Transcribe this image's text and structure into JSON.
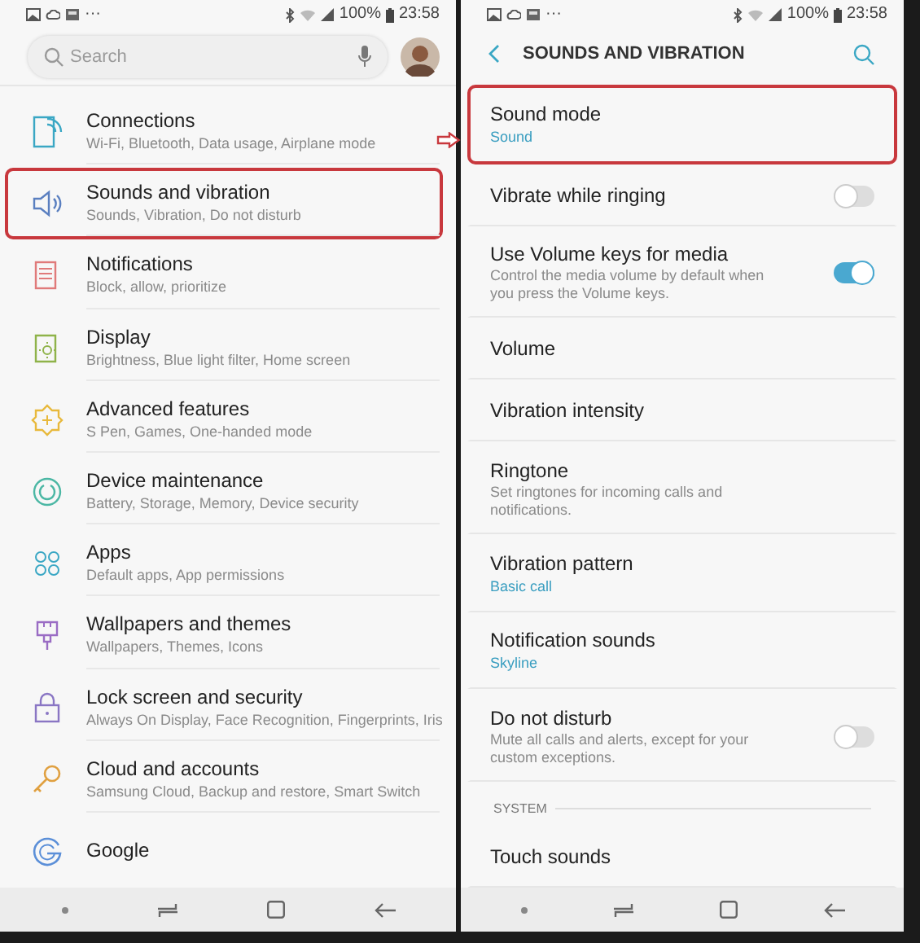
{
  "left_screen": {
    "status_bar": {
      "overflow": "···",
      "battery": "100%",
      "time": "23:58"
    },
    "search": {
      "placeholder": "Search"
    },
    "settings": [
      {
        "title": "Connections",
        "subtitle": "Wi-Fi, Bluetooth, Data usage, Airplane mode",
        "highlighted": false
      },
      {
        "title": "Sounds and vibration",
        "subtitle": "Sounds, Vibration, Do not disturb",
        "highlighted": true
      },
      {
        "title": "Notifications",
        "subtitle": "Block, allow, prioritize",
        "highlighted": false
      },
      {
        "title": "Display",
        "subtitle": "Brightness, Blue light filter, Home screen",
        "highlighted": false
      },
      {
        "title": "Advanced features",
        "subtitle": "S Pen, Games, One-handed mode",
        "highlighted": false
      },
      {
        "title": "Device maintenance",
        "subtitle": "Battery, Storage, Memory, Device security",
        "highlighted": false
      },
      {
        "title": "Apps",
        "subtitle": "Default apps, App permissions",
        "highlighted": false
      },
      {
        "title": "Wallpapers and themes",
        "subtitle": "Wallpapers, Themes, Icons",
        "highlighted": false
      },
      {
        "title": "Lock screen and security",
        "subtitle": "Always On Display, Face Recognition, Fingerprints, Iris",
        "highlighted": false
      },
      {
        "title": "Cloud and accounts",
        "subtitle": "Samsung Cloud, Backup and restore, Smart Switch",
        "highlighted": false
      },
      {
        "title": "Google",
        "highlighted": false
      }
    ]
  },
  "right_screen": {
    "status_bar": {
      "overflow": "···",
      "battery": "100%",
      "time": "23:58"
    },
    "title": "SOUNDS AND VIBRATION",
    "settings": [
      {
        "kind": "link",
        "title": "Sound mode",
        "value": "Sound",
        "highlighted": true
      },
      {
        "kind": "switch",
        "title": "Vibrate while ringing",
        "on": false,
        "highlighted": false
      },
      {
        "kind": "switch",
        "title": "Use Volume keys for media",
        "description": "Control the media volume by default when you press the Volume keys.",
        "on": true,
        "highlighted": false
      },
      {
        "kind": "link",
        "title": "Volume",
        "highlighted": false
      },
      {
        "kind": "link",
        "title": "Vibration intensity",
        "highlighted": false
      },
      {
        "kind": "link",
        "title": "Ringtone",
        "description": "Set ringtones for incoming calls and notifications.",
        "highlighted": false
      },
      {
        "kind": "link",
        "title": "Vibration pattern",
        "value": "Basic call",
        "highlighted": false
      },
      {
        "kind": "link",
        "title": "Notification sounds",
        "value": "Skyline",
        "highlighted": false
      },
      {
        "kind": "switch",
        "title": "Do not disturb",
        "description": "Mute all calls and alerts, except for your custom exceptions.",
        "on": false,
        "highlighted": false
      },
      {
        "kind": "header",
        "title": "SYSTEM"
      },
      {
        "kind": "link",
        "title": "Touch sounds",
        "highlighted": false
      }
    ]
  }
}
